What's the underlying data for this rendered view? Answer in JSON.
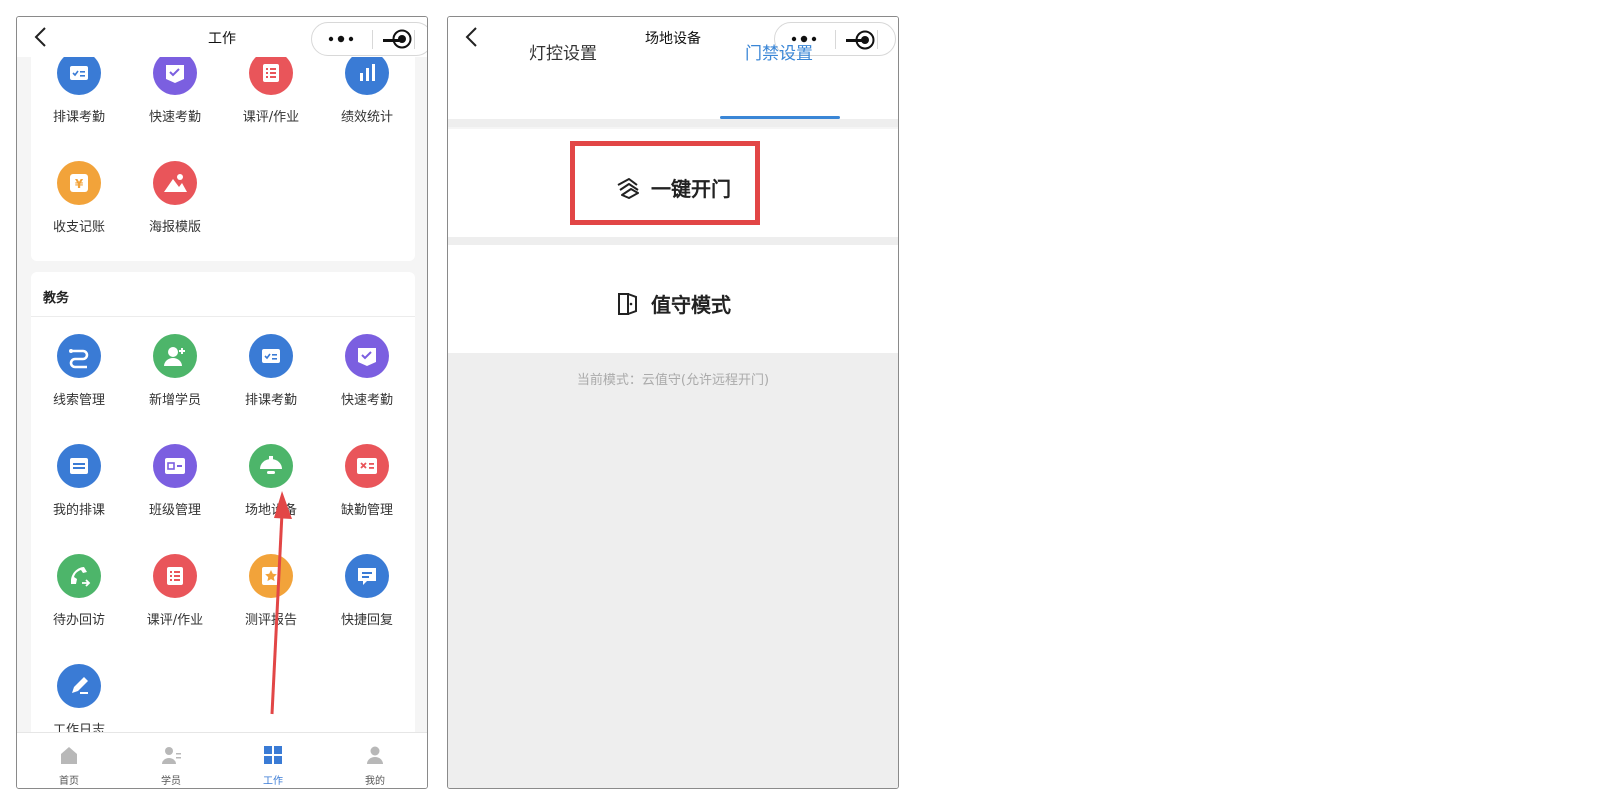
{
  "colors": {
    "blue": "#3a7bd5",
    "purple": "#7b5fe0",
    "red": "#e9555a",
    "green": "#4db56a",
    "orange": "#f2a33a",
    "active_tab": "#3a86d6",
    "highlight": "#e24646"
  },
  "left_screen": {
    "title": "工作",
    "top_section": {
      "items": [
        {
          "label": "排课考勤",
          "icon": "checklist-icon"
        },
        {
          "label": "快速考勤",
          "icon": "check-badge-icon"
        },
        {
          "label": "课评/作业",
          "icon": "list-icon"
        },
        {
          "label": "绩效统计",
          "icon": "bar-chart-icon"
        },
        {
          "label": "收支记账",
          "icon": "yuan-icon"
        },
        {
          "label": "海报模版",
          "icon": "image-icon"
        }
      ]
    },
    "edu_section": {
      "title": "教务",
      "items": [
        {
          "label": "线索管理",
          "icon": "route-icon"
        },
        {
          "label": "新增学员",
          "icon": "add-user-icon"
        },
        {
          "label": "排课考勤",
          "icon": "checklist-icon"
        },
        {
          "label": "快速考勤",
          "icon": "check-badge-icon"
        },
        {
          "label": "我的排课",
          "icon": "schedule-icon"
        },
        {
          "label": "班级管理",
          "icon": "id-card-icon"
        },
        {
          "label": "场地设备",
          "icon": "lamp-icon"
        },
        {
          "label": "缺勤管理",
          "icon": "absence-icon"
        },
        {
          "label": "待办回访",
          "icon": "phone-icon"
        },
        {
          "label": "课评/作业",
          "icon": "list-icon"
        },
        {
          "label": "测评报告",
          "icon": "star-report-icon"
        },
        {
          "label": "快捷回复",
          "icon": "message-icon"
        },
        {
          "label": "工作日志",
          "icon": "edit-icon"
        }
      ]
    },
    "tabbar": [
      {
        "label": "首页",
        "icon": "home-icon"
      },
      {
        "label": "学员",
        "icon": "students-icon"
      },
      {
        "label": "工作",
        "icon": "grid-icon"
      },
      {
        "label": "我的",
        "icon": "profile-icon"
      }
    ]
  },
  "right_screen": {
    "title": "场地设备",
    "tabs": [
      {
        "label": "灯控设置"
      },
      {
        "label": "门禁设置"
      }
    ],
    "active_tab": "门禁设置",
    "one_click_open": "一键开门",
    "guard_mode": "值守模式",
    "current_mode": "当前模式：云值守(允许远程开门)"
  }
}
